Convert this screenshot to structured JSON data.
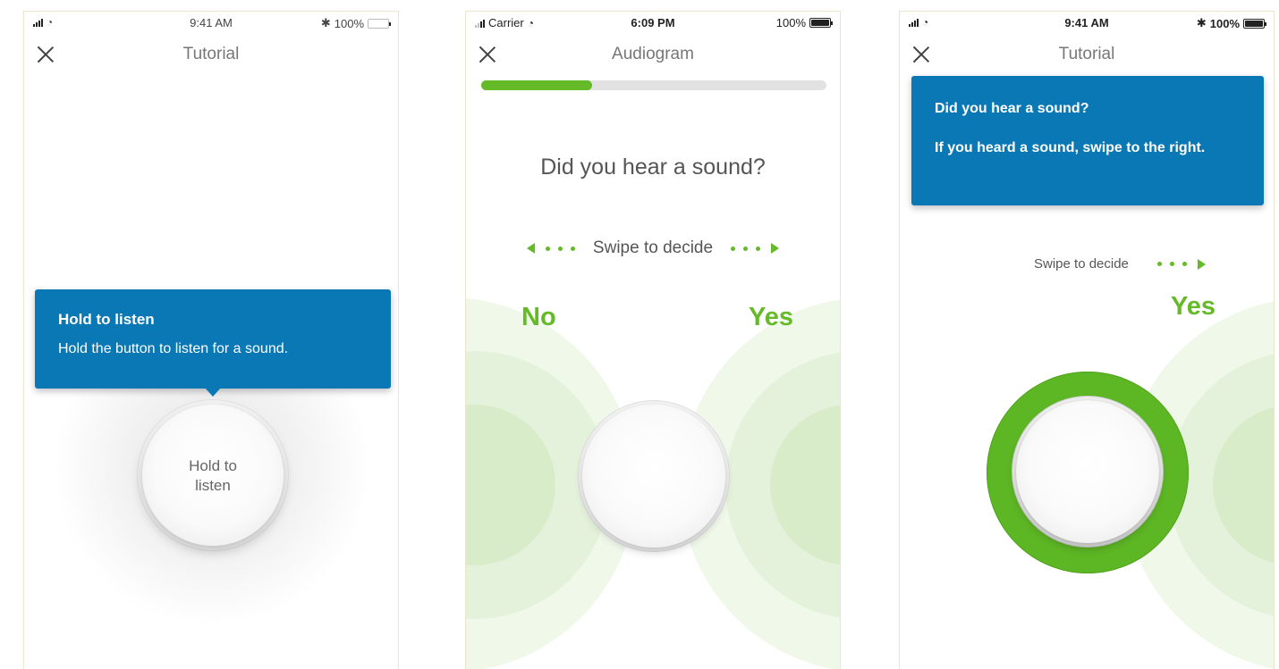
{
  "colors": {
    "accent_green": "#65ba28",
    "tooltip_blue": "#0a78b4",
    "progress_track": "#e2e2e2"
  },
  "screens": [
    {
      "status": {
        "time": "9:41 AM",
        "battery": "100%"
      },
      "nav": {
        "title": "Tutorial",
        "close_icon": "close-icon"
      },
      "tooltip": {
        "title": "Hold to listen",
        "body": "Hold the button to listen for a sound."
      },
      "button": {
        "line1": "Hold to",
        "line2": "listen"
      }
    },
    {
      "status": {
        "carrier": "Carrier",
        "time": "6:09 PM",
        "battery": "100%"
      },
      "nav": {
        "title": "Audiogram",
        "close_icon": "close-icon"
      },
      "progress": 0.32,
      "question": "Did you hear a sound?",
      "swipe_hint": "Swipe to decide",
      "no_label": "No",
      "yes_label": "Yes"
    },
    {
      "status": {
        "time": "9:41 AM",
        "battery": "100%"
      },
      "nav": {
        "title": "Tutorial",
        "close_icon": "close-icon"
      },
      "tooltip": {
        "title": "Did you hear a sound?",
        "body": "If you heard a sound, swipe to the right."
      },
      "swipe_hint": "Swipe to decide",
      "yes_label": "Yes"
    }
  ]
}
